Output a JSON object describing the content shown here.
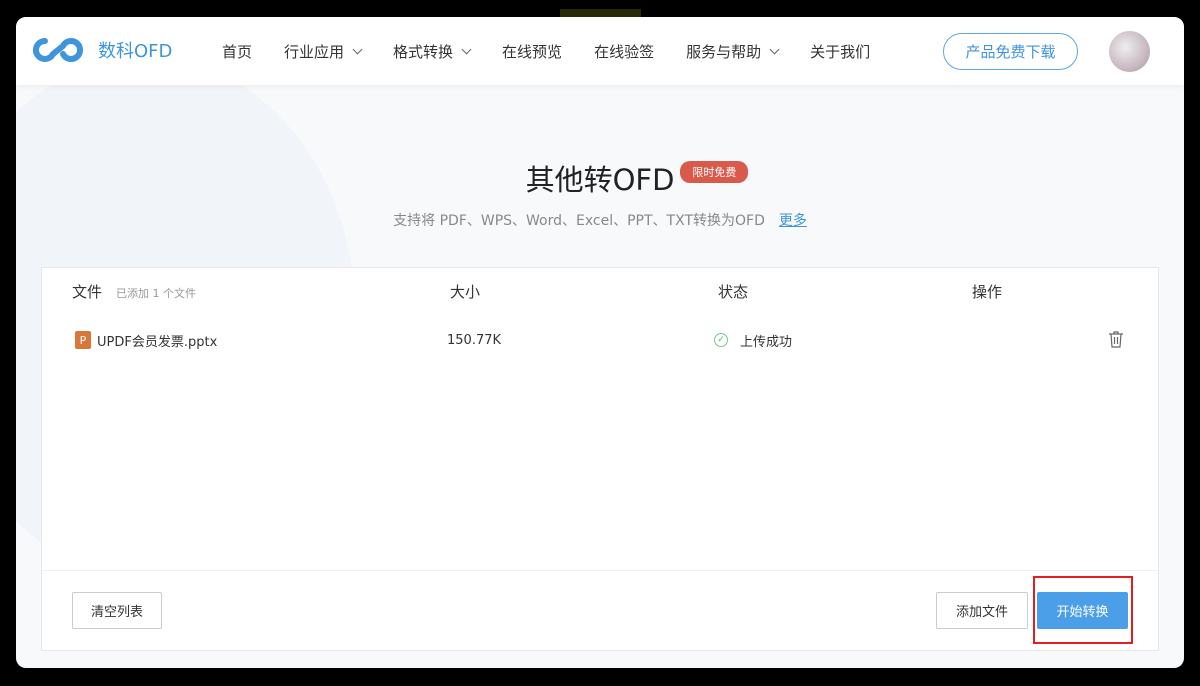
{
  "header": {
    "logo_text": "数科OFD",
    "nav": [
      {
        "label": "首页",
        "dropdown": false
      },
      {
        "label": "行业应用",
        "dropdown": true
      },
      {
        "label": "格式转换",
        "dropdown": true
      },
      {
        "label": "在线预览",
        "dropdown": false
      },
      {
        "label": "在线验签",
        "dropdown": false
      },
      {
        "label": "服务与帮助",
        "dropdown": true
      },
      {
        "label": "关于我们",
        "dropdown": false
      }
    ],
    "download_button": "产品免费下载"
  },
  "hero": {
    "title": "其他转OFD",
    "badge": "限时免费",
    "subtitle": "支持将 PDF、WPS、Word、Excel、PPT、TXT转换为OFD",
    "more_link": "更多"
  },
  "table": {
    "headers": {
      "file": "文件",
      "file_count": "已添加 1 个文件",
      "size": "大小",
      "status": "状态",
      "action": "操作"
    },
    "rows": [
      {
        "icon_letter": "P",
        "name": "UPDF会员发票.pptx",
        "size": "150.77K",
        "status": "上传成功"
      }
    ]
  },
  "footer": {
    "clear": "清空列表",
    "add": "添加文件",
    "start": "开始转换"
  },
  "colors": {
    "brand": "#3f95dd",
    "badge": "#d9594a",
    "primary_button": "#4a9fe8",
    "highlight": "#e02020"
  }
}
